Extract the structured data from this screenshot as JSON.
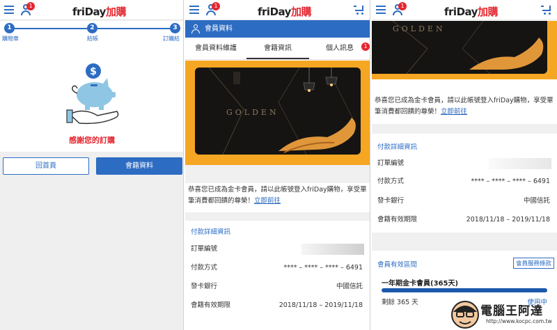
{
  "colors": {
    "accent": "#2d6cc3",
    "alert": "#e4262f",
    "gold": "#f5a623"
  },
  "header": {
    "notif_count": "1",
    "logo_main": "friDay",
    "logo_suffix": "加購"
  },
  "panel1": {
    "steps": [
      {
        "num": "1",
        "label": "購物車"
      },
      {
        "num": "2",
        "label": "結帳"
      },
      {
        "num": "3",
        "label": "訂購結果"
      }
    ],
    "thanks": "感謝您的訂購",
    "home_button": "回首頁",
    "member_button": "會籍資料"
  },
  "member": {
    "title": "會員資料",
    "tabs": [
      "會員資料維護",
      "會籍資訊",
      "個人訊息"
    ],
    "active_tab": "會籍資訊",
    "message_badge": "1",
    "card_text": "GOLDEN",
    "congrats": "恭喜您已成為金卡會員，請以此帳號登入friDay購物，享受單筆消費都回饋的尊榮！",
    "go_link": "立即前往",
    "payment_title": "付款詳細資訊",
    "rows": [
      {
        "label": "訂單編號",
        "value": ""
      },
      {
        "label": "付款方式",
        "value": "**** – **** – **** – 6491"
      },
      {
        "label": "發卡銀行",
        "value": "中國信託"
      },
      {
        "label": "會籍有效期限",
        "value": "2018/11/18 – 2019/11/18"
      }
    ],
    "validity_title": "會員有效區間",
    "terms_button": "會員服務條款",
    "plan_title": "一年期金卡會員(365天)",
    "remaining": "剩餘 365 天",
    "in_use": "使用中",
    "remaining_fraction": 1.0
  },
  "watermark": {
    "name": "電腦王阿達",
    "url": "http://www.kocpc.com.tw"
  }
}
